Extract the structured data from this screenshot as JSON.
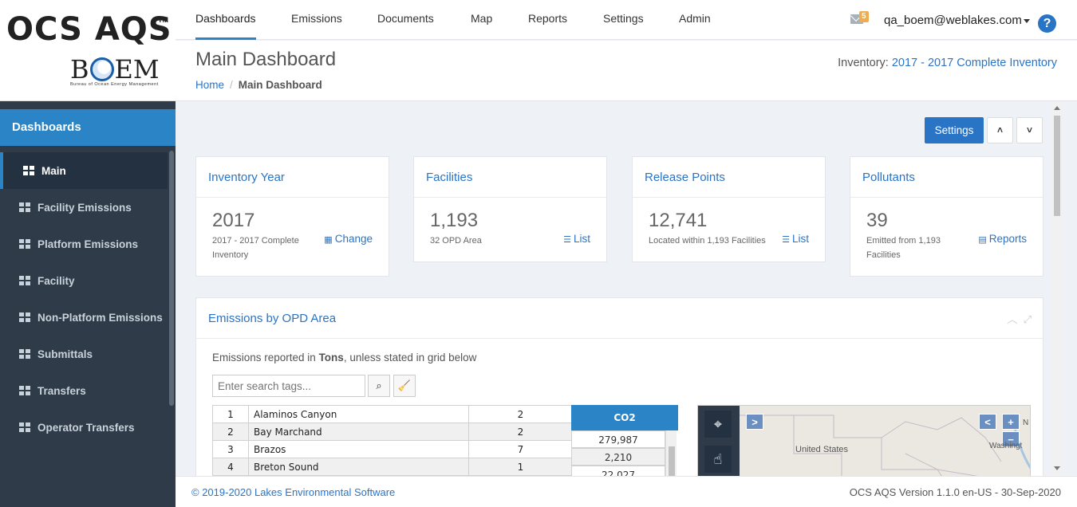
{
  "brand": {
    "title": "OCS AQS",
    "tm": "TM",
    "boem": "BOEM",
    "boem_sub": "Bureau of Ocean Energy Management"
  },
  "nav": {
    "tabs": [
      "Dashboards",
      "Emissions",
      "Documents",
      "Map",
      "Reports",
      "Settings",
      "Admin"
    ],
    "active_tab": "Dashboards",
    "mail_count": "5",
    "user": "qa_boem@weblakes.com",
    "help": "?"
  },
  "sidebar": {
    "header": "Dashboards",
    "items": [
      {
        "label": "Main",
        "active": true
      },
      {
        "label": "Facility Emissions"
      },
      {
        "label": "Platform Emissions"
      },
      {
        "label": "Facility"
      },
      {
        "label": "Non-Platform Emissions"
      },
      {
        "label": "Submittals"
      },
      {
        "label": "Transfers"
      },
      {
        "label": "Operator Transfers"
      }
    ]
  },
  "page": {
    "title": "Main Dashboard",
    "breadcrumb": {
      "home": "Home",
      "current": "Main Dashboard"
    },
    "inventory_label": "Inventory:",
    "inventory_value": "2017 - 2017 Complete Inventory"
  },
  "toolbar": {
    "settings": "Settings",
    "collapse_all": "˄",
    "expand_all": "˅"
  },
  "cards": [
    {
      "title": "Inventory Year",
      "value": "2017",
      "sub": "2017 - 2017 Complete Inventory",
      "link": "Change",
      "icon": "calendar-icon"
    },
    {
      "title": "Facilities",
      "value": "1,193",
      "sub": "32 OPD Area",
      "link": "List",
      "icon": "list-icon"
    },
    {
      "title": "Release Points",
      "value": "12,741",
      "sub": "Located within 1,193 Facilities",
      "link": "List",
      "icon": "list-icon"
    },
    {
      "title": "Pollutants",
      "value": "39",
      "sub": "Emitted from 1,193 Facilities",
      "link": "Reports",
      "icon": "document-icon"
    }
  ],
  "emissions_panel": {
    "title": "Emissions by OPD Area",
    "note_prefix": "Emissions reported in ",
    "note_unit": "Tons",
    "note_suffix": ", unless stated in grid below",
    "search_placeholder": "Enter search tags...",
    "rows": [
      {
        "n": "1",
        "area": "Alaminos Canyon",
        "count": "2"
      },
      {
        "n": "2",
        "area": "Bay Marchand",
        "count": "2"
      },
      {
        "n": "3",
        "area": "Brazos",
        "count": "7"
      },
      {
        "n": "4",
        "area": "Breton Sound",
        "count": "1"
      }
    ],
    "co2_header": "CO2",
    "co2_values": [
      "279,987",
      "2,210",
      "22,027"
    ]
  },
  "map": {
    "label_us": "United States",
    "label_wash": "Washingt",
    "label_n": "N"
  },
  "footer": {
    "copyright": "© 2019-2020 Lakes Environmental Software",
    "version": "OCS AQS Version 1.1.0 en-US - 30-Sep-2020"
  },
  "colors": {
    "accent": "#2a84c6",
    "link": "#2a74c6",
    "sidebar": "#2f3b48",
    "badge": "#f0ad4e"
  }
}
